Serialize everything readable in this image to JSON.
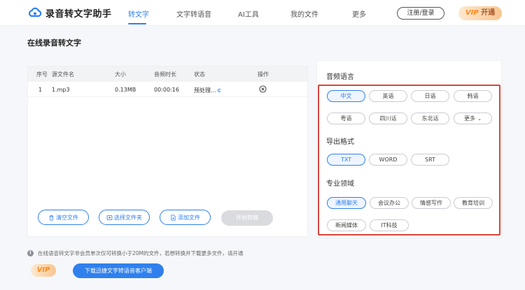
{
  "app": {
    "name": "录音转文字助手"
  },
  "nav": {
    "items": [
      "转文字",
      "文字转语音",
      "AI工具",
      "我的文件",
      "更多"
    ],
    "active": "转文字",
    "login_label": "注册/登录",
    "vip_v": "VIP",
    "vip_label": "开通"
  },
  "page": {
    "title": "在线录音转文字"
  },
  "table": {
    "headers": [
      "序号",
      "源文件名",
      "大小",
      "音频时长",
      "状态",
      "操作"
    ],
    "rows": [
      {
        "index": "1",
        "name": "1.mp3",
        "size": "0.13MB",
        "duration": "00:00:16",
        "status": "预处理..."
      }
    ]
  },
  "actions": {
    "clear": "清空文件",
    "choose_folder": "选择文件夹",
    "add_file": "添加文件",
    "start": "开始转换"
  },
  "note": "在线语音转文字非会员单次仅可转换小于20M的文件，若想转换并下载更多文件，请开通",
  "bottom": {
    "vip": "VIP",
    "download_label": "下载迅捷文字转语音客户端"
  },
  "settings": {
    "language": {
      "title": "音频语言",
      "options": [
        "中文",
        "英语",
        "日语",
        "韩语",
        "粤语",
        "四川话",
        "东北话",
        "更多"
      ],
      "selected": "中文"
    },
    "format": {
      "title": "导出格式",
      "options": [
        "TXT",
        "WORD",
        "SRT"
      ],
      "selected": "TXT"
    },
    "domain": {
      "title": "专业领域",
      "options": [
        "通用聊天",
        "会议办公",
        "情感写作",
        "教育培训",
        "新闻媒体",
        "IT科技"
      ],
      "selected": "通用聊天"
    }
  },
  "colors": {
    "accent": "#2f80ed",
    "highlight_box": "#d9443a",
    "vip_text": "#ff8a1f"
  }
}
